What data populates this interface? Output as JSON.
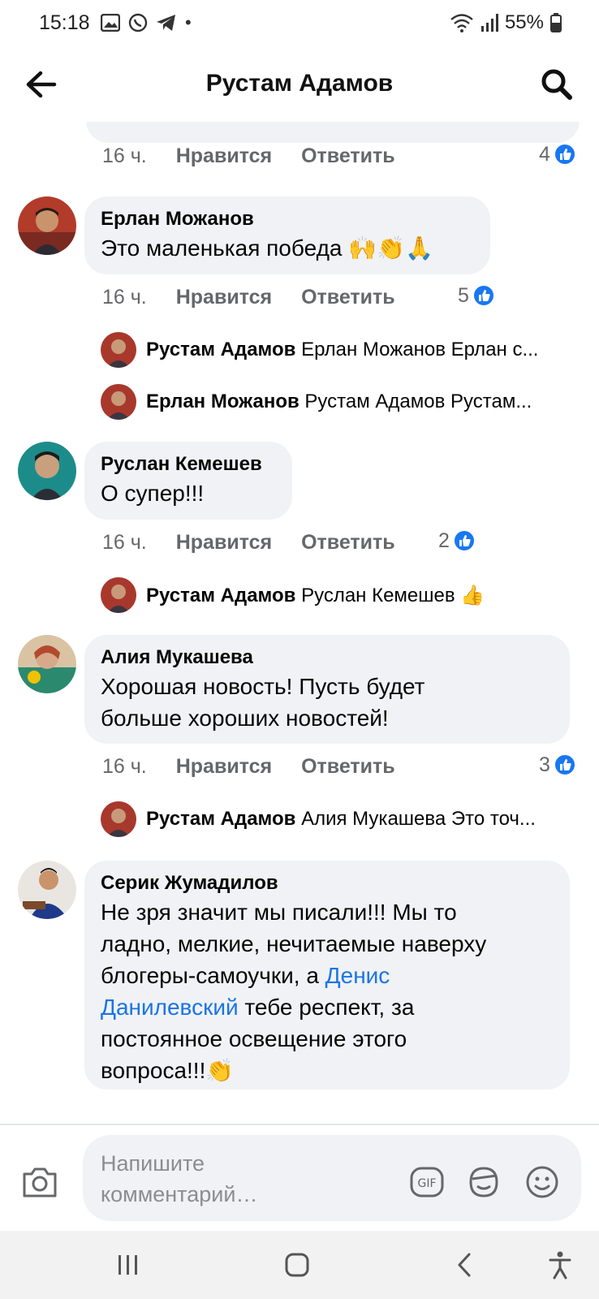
{
  "status_bar": {
    "time": "15:18",
    "battery": "55%",
    "left_icons": [
      "gallery-icon",
      "whatsapp-icon",
      "telegram-icon",
      "dot-icon"
    ],
    "right_icons": [
      "wifi-icon",
      "signal-icon",
      "battery-icon"
    ]
  },
  "header": {
    "title": "Рустам Адамов",
    "back_icon": "arrow-left-icon",
    "search_icon": "search-icon"
  },
  "previous_comment_meta": {
    "time": "16 ч.",
    "like_label": "Нравится",
    "reply_label": "Ответить",
    "reaction_count": "4"
  },
  "comments": [
    {
      "author": "Ерлан Можанов",
      "text": "Это маленькая победа",
      "emojis": "🙌👏🙏",
      "time": "16 ч.",
      "like_label": "Нравится",
      "reply_label": "Ответить",
      "reaction_count": "5",
      "replies": [
        {
          "author": "Рустам Адамов",
          "text": "Ерлан Можанов Ерлан с..."
        },
        {
          "author": "Ерлан Можанов",
          "text": "Рустам Адамов Рустам..."
        }
      ]
    },
    {
      "author": "Руслан Кемешев",
      "text": "О супер!!!",
      "time": "16 ч.",
      "like_label": "Нравится",
      "reply_label": "Ответить",
      "reaction_count": "2",
      "replies": [
        {
          "author": "Рустам Адамов",
          "text": "Руслан Кемешев",
          "emoji": "👍"
        }
      ]
    },
    {
      "author": "Алия Мукашева",
      "text_line1": "Хорошая новость! Пусть будет",
      "text_line2": "больше хороших новостей!",
      "time": "16 ч.",
      "like_label": "Нравится",
      "reply_label": "Ответить",
      "reaction_count": "3",
      "replies": [
        {
          "author": "Рустам Адамов",
          "text": "Алия Мукашева Это точ..."
        }
      ]
    },
    {
      "author": "Серик Жумадилов",
      "line1": "Не зря значит мы писали!!! Мы то",
      "line2": "ладно, мелкие, нечитаемые наверху",
      "line3_before": "блогеры-самоучки, а ",
      "line3_link": "Денис",
      "line4_link": "Данилевский",
      "line4_after": " тебе респект, за",
      "line5": "постоянное освещение этого",
      "line6": "вопроса!!!",
      "emoji": "👏"
    }
  ],
  "composer": {
    "placeholder": "Напишите комментарий…",
    "icons": [
      "camera-icon",
      "gif-icon",
      "sticker-icon",
      "emoji-icon"
    ]
  },
  "nav_bar": {
    "icons": [
      "recent-apps-icon",
      "home-icon",
      "back-icon",
      "accessibility-icon"
    ]
  },
  "colors": {
    "bubble_bg": "#f0f2f5",
    "link": "#1b74e4",
    "like_badge": "#1877f2",
    "meta_text": "#65676b"
  }
}
